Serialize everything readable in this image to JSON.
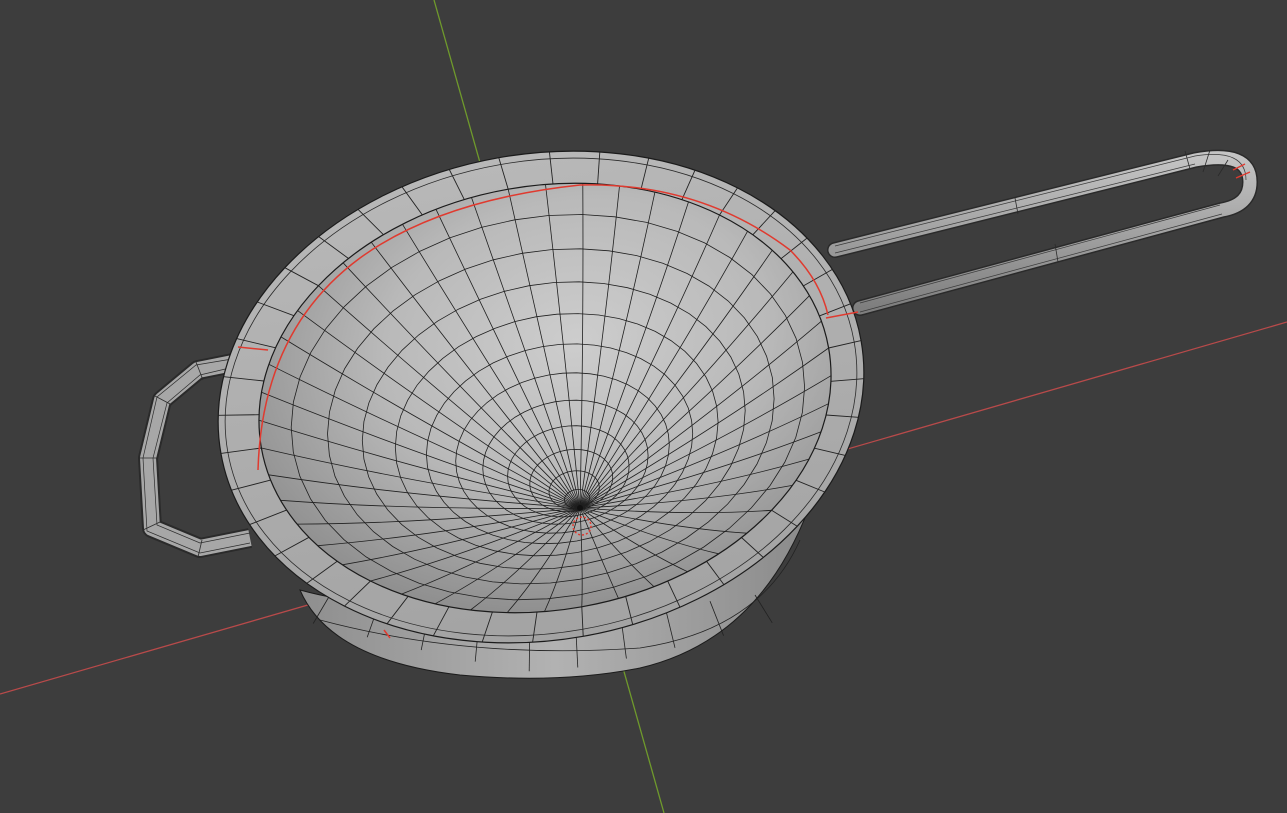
{
  "app": {
    "name": "3D viewport",
    "mode": "edit-mode-wireframe-overlay"
  },
  "viewport": {
    "background_color": "#3d3d3d",
    "x_axis_color": "#b84a4a",
    "y_axis_color": "#6f9a2c",
    "mesh_fill_color": "#a9a9a9",
    "mesh_edge_color": "#1b1b1b",
    "seam_color": "#e03a2f",
    "object": "strainer-mesh"
  }
}
